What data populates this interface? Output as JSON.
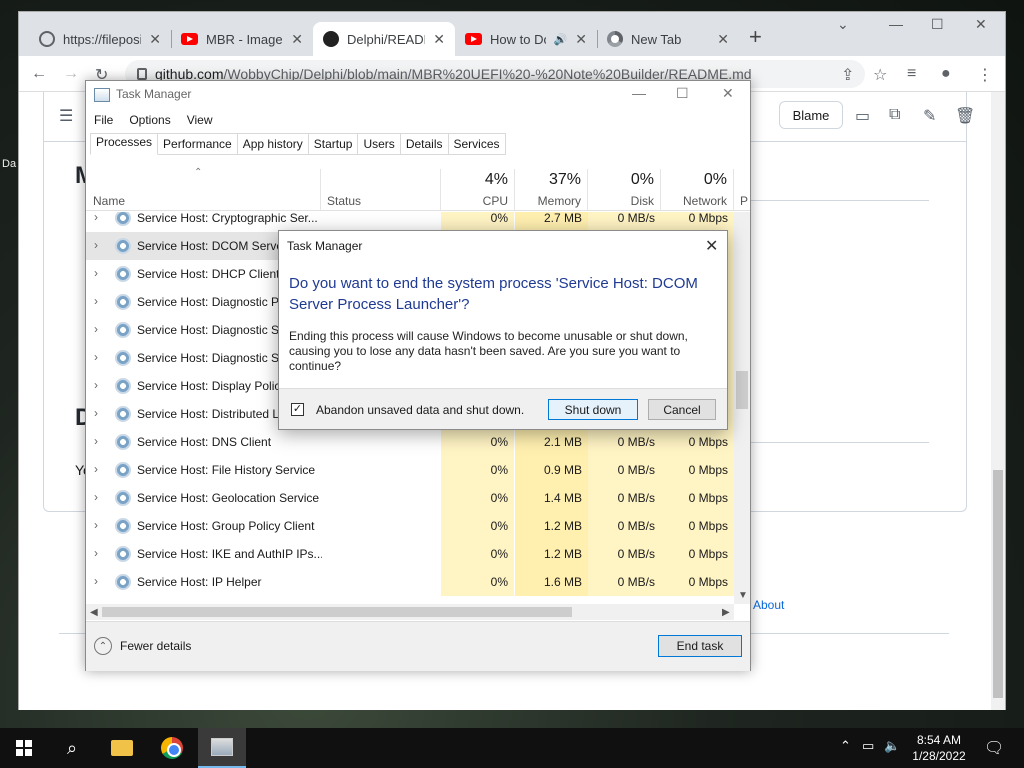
{
  "desktop": {
    "label": "Da"
  },
  "browser": {
    "tabs": [
      {
        "title": "https://fileposi",
        "icon": "globe-icon"
      },
      {
        "title": "MBR - Image",
        "icon": "youtube-icon"
      },
      {
        "title": "Delphi/READM",
        "icon": "github-icon"
      },
      {
        "title": "How to Do",
        "icon": "youtube-icon"
      },
      {
        "title": "New Tab",
        "icon": "chrome-icon"
      }
    ],
    "url_host": "github.com",
    "url_path": "/WobbyChip/Delphi/blob/main/MBR%20UEFI%20-%20Note%20Builder/README.md"
  },
  "github": {
    "blame_label": "Blame",
    "about_label": "About",
    "frag_m": "M",
    "frag_d": "D",
    "frag_y": "Yo"
  },
  "task_manager": {
    "title": "Task Manager",
    "menu": [
      "File",
      "Options",
      "View"
    ],
    "tabs": [
      "Processes",
      "Performance",
      "App history",
      "Startup",
      "Users",
      "Details",
      "Services"
    ],
    "columns": {
      "name": "Name",
      "status": "Status",
      "cpu": {
        "pct": "4%",
        "label": "CPU"
      },
      "memory": {
        "pct": "37%",
        "label": "Memory"
      },
      "disk": {
        "pct": "0%",
        "label": "Disk"
      },
      "network": {
        "pct": "0%",
        "label": "Network"
      },
      "power": "P"
    },
    "rows": [
      {
        "name": "Service Host: Cryptographic Ser...",
        "cpu": "0%",
        "mem": "2.7 MB",
        "disk": "0 MB/s",
        "net": "0 Mbps"
      },
      {
        "name": "Service Host: DCOM Server",
        "cpu": "",
        "mem": "",
        "disk": "",
        "net": ""
      },
      {
        "name": "Service Host: DHCP Client",
        "cpu": "",
        "mem": "",
        "disk": "",
        "net": ""
      },
      {
        "name": "Service Host: Diagnostic Po",
        "cpu": "",
        "mem": "",
        "disk": "",
        "net": ""
      },
      {
        "name": "Service Host: Diagnostic Se",
        "cpu": "",
        "mem": "",
        "disk": "",
        "net": ""
      },
      {
        "name": "Service Host: Diagnostic Sy",
        "cpu": "",
        "mem": "",
        "disk": "",
        "net": ""
      },
      {
        "name": "Service Host: Display Policy",
        "cpu": "",
        "mem": "",
        "disk": "",
        "net": ""
      },
      {
        "name": "Service Host: Distributed Li",
        "cpu": "",
        "mem": "",
        "disk": "",
        "net": ""
      },
      {
        "name": "Service Host: DNS Client",
        "cpu": "0%",
        "mem": "2.1 MB",
        "disk": "0 MB/s",
        "net": "0 Mbps"
      },
      {
        "name": "Service Host: File History Service",
        "cpu": "0%",
        "mem": "0.9 MB",
        "disk": "0 MB/s",
        "net": "0 Mbps"
      },
      {
        "name": "Service Host: Geolocation Service",
        "cpu": "0%",
        "mem": "1.4 MB",
        "disk": "0 MB/s",
        "net": "0 Mbps"
      },
      {
        "name": "Service Host: Group Policy Client",
        "cpu": "0%",
        "mem": "1.2 MB",
        "disk": "0 MB/s",
        "net": "0 Mbps"
      },
      {
        "name": "Service Host: IKE and AuthIP IPs...",
        "cpu": "0%",
        "mem": "1.2 MB",
        "disk": "0 MB/s",
        "net": "0 Mbps"
      },
      {
        "name": "Service Host: IP Helper",
        "cpu": "0%",
        "mem": "1.6 MB",
        "disk": "0 MB/s",
        "net": "0 Mbps"
      }
    ],
    "fewer_details": "Fewer details",
    "end_task": "End task"
  },
  "dialog": {
    "title": "Task Manager",
    "question": "Do you want to end the system process 'Service Host: DCOM Server Process Launcher'?",
    "body": "Ending this process will cause Windows to become unusable or shut down, causing you to lose any data hasn't been saved. Are you sure you want to continue?",
    "checkbox_label": "Abandon unsaved data and shut down.",
    "checkbox_checked": true,
    "shutdown_label": "Shut down",
    "cancel_label": "Cancel"
  },
  "taskbar": {
    "time": "8:54 AM",
    "date": "1/28/2022"
  }
}
